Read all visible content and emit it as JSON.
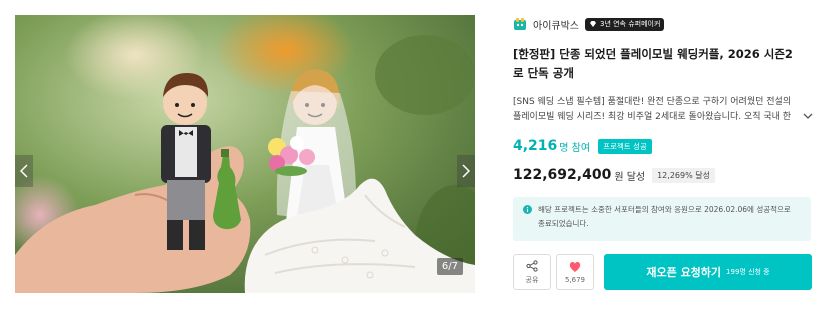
{
  "gallery": {
    "counter": "6/7",
    "prev_icon": "chevron-left-icon",
    "next_icon": "chevron-right-icon"
  },
  "maker": {
    "name": "아이큐박스",
    "badge": "3년 연속 슈퍼메이커",
    "badge_icon": "diamond-icon"
  },
  "project": {
    "title": "[한정판] 단종 되었던 플레이모빌 웨딩커플, 2026 시즌2로 단독 공개",
    "description": "[SNS 웨딩 스냅 필수템] 품절대란! 완전 단종으로 구하기 어려웠던 전설의 플레이모빌 웨딩 시리즈! 최강 비주얼 2세대로 돌아왔습니다. 오직 국내 한정, 위드…"
  },
  "stats": {
    "supporters": "4,216",
    "supporters_unit": "명 참여",
    "status_badge": "프로젝트 성공",
    "amount": "122,692,400",
    "amount_unit": "원 달성",
    "percent": "12,269% 달성"
  },
  "notice": {
    "text_line1": "해당 프로젝트는 소중한 서포터들의 참여와 응원으로 2026.02.06에 성공적으로",
    "text_line2": "종료되었습니다."
  },
  "actions": {
    "share_label": "공유",
    "like_count": "5,679",
    "primary_label": "재오픈 요청하기",
    "primary_sub": "199명 신청 중"
  },
  "colors": {
    "accent": "#00c4c4",
    "accent_text": "#00b2b2",
    "notice_bg": "#e9f7f7",
    "heart": "#ff5a6e"
  }
}
